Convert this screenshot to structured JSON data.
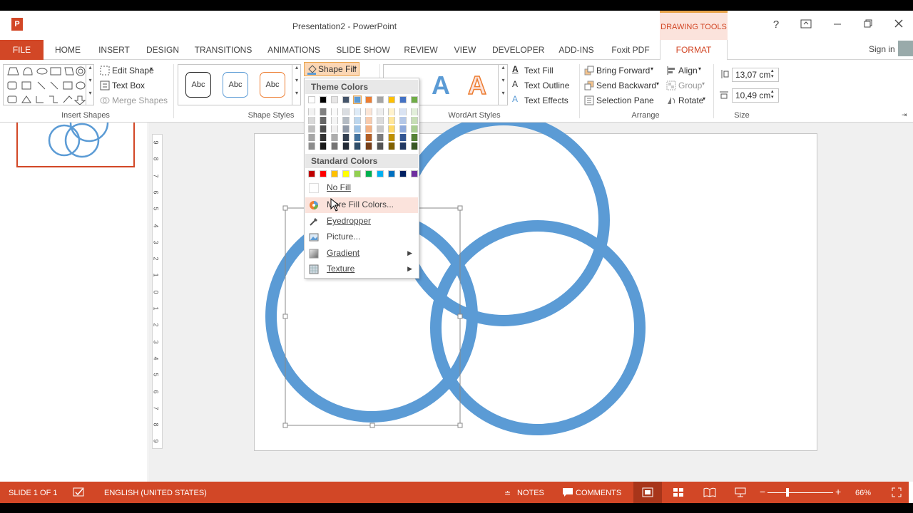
{
  "window": {
    "title": "Presentation2 - PowerPoint",
    "contextual": "DRAWING TOOLS",
    "help": "?",
    "ppt_letter": "P"
  },
  "tabs": [
    "FILE",
    "HOME",
    "INSERT",
    "DESIGN",
    "TRANSITIONS",
    "ANIMATIONS",
    "SLIDE SHOW",
    "REVIEW",
    "VIEW",
    "DEVELOPER",
    "ADD-INS",
    "Foxit PDF",
    "FORMAT"
  ],
  "signin": "Sign in",
  "ribbon": {
    "insert_shapes": {
      "edit_shape": "Edit Shape",
      "text_box": "Text Box",
      "merge_shapes": "Merge Shapes",
      "label": "Insert Shapes"
    },
    "shape_styles": {
      "abc": "Abc",
      "shape_fill": "Shape Fill",
      "label": "Shape Styles"
    },
    "wordart": {
      "letter": "A",
      "text_fill": "Text Fill",
      "text_outline": "Text Outline",
      "text_effects": "Text Effects",
      "label": "WordArt Styles"
    },
    "arrange": {
      "bring_forward": "Bring Forward",
      "send_backward": "Send Backward",
      "selection_pane": "Selection Pane",
      "align": "Align",
      "group": "Group",
      "rotate": "Rotate",
      "label": "Arrange"
    },
    "size": {
      "height": "13,07 cm",
      "width": "10,49 cm",
      "label": "Size"
    }
  },
  "menu": {
    "theme_colors": "Theme Colors",
    "standard_colors": "Standard Colors",
    "items": [
      "No Fill",
      "More Fill Colors...",
      "Eyedropper",
      "Picture...",
      "Gradient",
      "Texture"
    ],
    "theme_top": [
      "#ffffff",
      "#000000",
      "#e7e6e6",
      "#44546a",
      "#5b9bd5",
      "#ed7d31",
      "#a5a5a5",
      "#ffc000",
      "#4472c4",
      "#70ad47"
    ],
    "standard": [
      "#c00000",
      "#ff0000",
      "#ffc000",
      "#ffff00",
      "#92d050",
      "#00b050",
      "#00b0f0",
      "#0070c0",
      "#002060",
      "#7030a0"
    ]
  },
  "ruler_ticks": [
    "9",
    "8",
    "7",
    "6",
    "5",
    "4",
    "3",
    "2",
    "1",
    "0",
    "1",
    "2",
    "3",
    "4",
    "5",
    "6",
    "7",
    "8",
    "9"
  ],
  "status": {
    "slide": "SLIDE 1 OF 1",
    "language": "ENGLISH (UNITED STATES)",
    "notes": "NOTES",
    "comments": "COMMENTS",
    "zoom": "66%"
  },
  "colors": {
    "accent": "#d24726",
    "ring": "#5b9bd5"
  }
}
